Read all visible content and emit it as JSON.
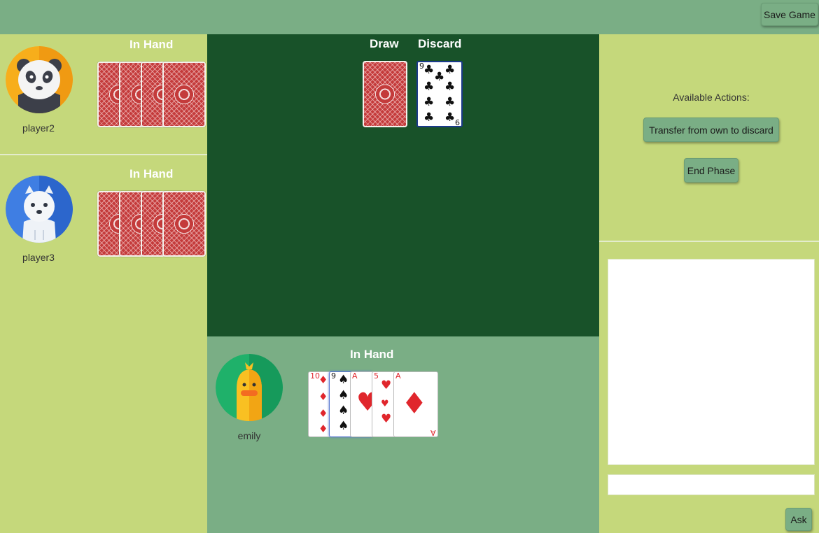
{
  "toolbar": {
    "save_label": "Save Game"
  },
  "opponents": [
    {
      "name": "player2",
      "hand_label": "In Hand",
      "card_count": 4,
      "avatar_icon": "panda-icon"
    },
    {
      "name": "player3",
      "hand_label": "In Hand",
      "card_count": 4,
      "avatar_icon": "polar-bear-icon"
    }
  ],
  "table": {
    "draw_label": "Draw",
    "discard_label": "Discard",
    "discard_top": {
      "rank": "9",
      "suit": "♣"
    }
  },
  "me": {
    "name": "emily",
    "hand_label": "In Hand",
    "avatar_icon": "duck-icon",
    "cards": [
      {
        "rank": "10",
        "suit": "♦"
      },
      {
        "rank": "9",
        "suit": "♠"
      },
      {
        "rank": "A",
        "suit": "♥"
      },
      {
        "rank": "5",
        "suit": "♥"
      },
      {
        "rank": "A",
        "suit": "♦"
      }
    ]
  },
  "actions": {
    "title": "Available Actions:",
    "transfer_label": "Transfer from own to discard",
    "end_phase_label": "End Phase"
  },
  "chat": {
    "message_value": "",
    "ask_label": "Ask"
  },
  "colors": {
    "topbar": "#7aae85",
    "side_panels": "#c5d87b",
    "table_felt": "#185229",
    "my_area": "#7aae85",
    "card_back": "#c43b3b"
  }
}
